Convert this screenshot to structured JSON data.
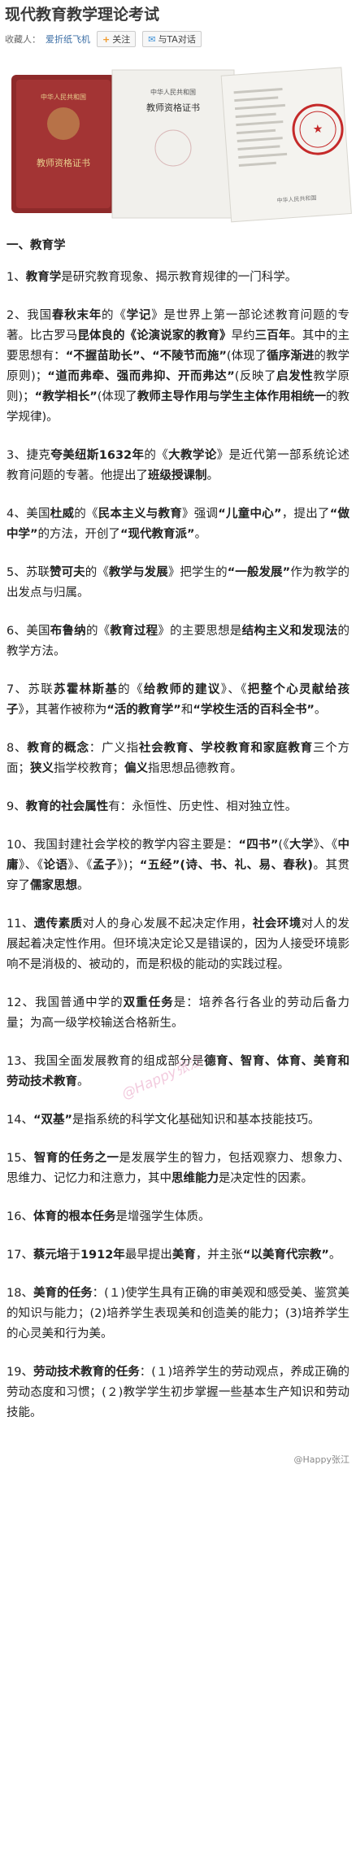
{
  "page": {
    "title": "现代教育教学理论考试",
    "meta": {
      "collector_label": "收藏人：",
      "author": "爱折纸飞机",
      "follow_label": "关注",
      "chat_label": "与TA对话"
    },
    "hero": {
      "card1_top": "中华人民共和国",
      "card1_main": "教师资格证书",
      "card2_top": "中华人民共和国",
      "card2_main": "教师资格证书",
      "card3_top": "中华人民共和国"
    },
    "section_title": "一、教育学",
    "paragraphs": [
      [
        {
          "t": "1、"
        },
        {
          "t": "教育学",
          "b": true
        },
        {
          "t": "是研究教育现象、揭示教育规律的一门科学。"
        }
      ],
      [
        {
          "t": "2、我国"
        },
        {
          "t": "春秋末年",
          "b": true
        },
        {
          "t": "的《"
        },
        {
          "t": "学记",
          "b": true
        },
        {
          "t": "》是世界上第一部论述教育问题的专著。比古罗马"
        },
        {
          "t": "昆体良的《论演说家的教育》",
          "b": true
        },
        {
          "t": "早约"
        },
        {
          "t": "三百年",
          "b": true
        },
        {
          "t": "。其中的主要思想有："
        },
        {
          "t": "“不握苗助长”、“不陵节而施”",
          "b": true
        },
        {
          "t": "(体现了"
        },
        {
          "t": "循序渐进",
          "b": true
        },
        {
          "t": "的教学原则)；"
        },
        {
          "t": "“道而弗牵、强而弗抑、开而弗达”",
          "b": true
        },
        {
          "t": "(反映了"
        },
        {
          "t": "启发性",
          "b": true
        },
        {
          "t": "教学原则)；"
        },
        {
          "t": "“教学相长”",
          "b": true
        },
        {
          "t": "(体现了"
        },
        {
          "t": "教师主导作用与学生主体作用相统一",
          "b": true
        },
        {
          "t": "的教学规律)。"
        }
      ],
      [
        {
          "t": "3、捷克"
        },
        {
          "t": "夸美纽斯1632年",
          "b": true
        },
        {
          "t": "的《"
        },
        {
          "t": "大教学论",
          "b": true
        },
        {
          "t": "》是近代第一部系统论述教育问题的专著。他提出了"
        },
        {
          "t": "班级授课制",
          "b": true
        },
        {
          "t": "。"
        }
      ],
      [
        {
          "t": "4、美国"
        },
        {
          "t": "杜威",
          "b": true
        },
        {
          "t": "的《"
        },
        {
          "t": "民本主义与教育",
          "b": true
        },
        {
          "t": "》强调"
        },
        {
          "t": "“儿童中心”",
          "b": true
        },
        {
          "t": "，提出了"
        },
        {
          "t": "“做中学”",
          "b": true
        },
        {
          "t": "的方法，开创了"
        },
        {
          "t": "“现代教育派”",
          "b": true
        },
        {
          "t": "。"
        }
      ],
      [
        {
          "t": "5、苏联"
        },
        {
          "t": "赞可夫",
          "b": true
        },
        {
          "t": "的《"
        },
        {
          "t": "教学与发展",
          "b": true
        },
        {
          "t": "》把学生的"
        },
        {
          "t": "“一般发展”",
          "b": true
        },
        {
          "t": "作为教学的出发点与归属。"
        }
      ],
      [
        {
          "t": "6、美国"
        },
        {
          "t": "布鲁纳",
          "b": true
        },
        {
          "t": "的《"
        },
        {
          "t": "教育过程",
          "b": true
        },
        {
          "t": "》的主要思想是"
        },
        {
          "t": "结构主义和发现法",
          "b": true
        },
        {
          "t": "的教学方法。"
        }
      ],
      [
        {
          "t": "7、苏联"
        },
        {
          "t": "苏霍林斯基",
          "b": true
        },
        {
          "t": "的《"
        },
        {
          "t": "给教师的建议",
          "b": true
        },
        {
          "t": "》、《"
        },
        {
          "t": "把整个心灵献给孩子",
          "b": true
        },
        {
          "t": "》，其著作被称为"
        },
        {
          "t": "“活的教育学”",
          "b": true
        },
        {
          "t": "和"
        },
        {
          "t": "“学校生活的百科全书”",
          "b": true
        },
        {
          "t": "。"
        }
      ],
      [
        {
          "t": "8、"
        },
        {
          "t": "教育的概念",
          "b": true
        },
        {
          "t": "：广义指"
        },
        {
          "t": "社会教育、学校教育和家庭教育",
          "b": true
        },
        {
          "t": "三个方面；"
        },
        {
          "t": "狭义",
          "b": true
        },
        {
          "t": "指学校教育；"
        },
        {
          "t": "偏义",
          "b": true
        },
        {
          "t": "指思想品德教育。"
        }
      ],
      [
        {
          "t": "9、"
        },
        {
          "t": "教育的社会属性",
          "b": true
        },
        {
          "t": "有：永恒性、历史性、相对独立性。"
        }
      ],
      [
        {
          "t": "10、我国封建社会学校的教学内容主要是："
        },
        {
          "t": "“四书”",
          "b": true
        },
        {
          "t": "(《"
        },
        {
          "t": "大学",
          "b": true
        },
        {
          "t": "》、《"
        },
        {
          "t": "中庸",
          "b": true
        },
        {
          "t": "》、《"
        },
        {
          "t": "论语",
          "b": true
        },
        {
          "t": "》、《"
        },
        {
          "t": "孟子",
          "b": true
        },
        {
          "t": "》)；"
        },
        {
          "t": "“五经”(诗、书、礼、易、春秋)",
          "b": true
        },
        {
          "t": "。其贯穿了"
        },
        {
          "t": "儒家思想",
          "b": true
        },
        {
          "t": "。"
        }
      ],
      [
        {
          "t": "11、"
        },
        {
          "t": "遗传素质",
          "b": true
        },
        {
          "t": "对人的身心发展不起决定作用，"
        },
        {
          "t": "社会环境",
          "b": true
        },
        {
          "t": "对人的发展起着决定性作用。但环境决定论又是错误的，因为人接受环境影响不是消极的、被动的，而是积极的能动的实践过程。"
        }
      ],
      [
        {
          "t": "12、我国普通中学的"
        },
        {
          "t": "双重任务",
          "b": true
        },
        {
          "t": "是：培养各行各业的劳动后备力量；为高一级学校输送合格新生。"
        }
      ],
      [
        {
          "t": "13、我国全面发展教育的组成部分是"
        },
        {
          "t": "德育、智育、体育、美育和劳动技术教育",
          "b": true
        },
        {
          "t": "。"
        }
      ],
      [
        {
          "t": "14、"
        },
        {
          "t": "“双基”",
          "b": true
        },
        {
          "t": "是指系统的科学文化基础知识和基本技能技巧。"
        }
      ],
      [
        {
          "t": "15、"
        },
        {
          "t": "智育的任务之一",
          "b": true
        },
        {
          "t": "是发展学生的智力，包括观察力、想象力、思维力、记忆力和注意力，其中"
        },
        {
          "t": "思维能力",
          "b": true
        },
        {
          "t": "是决定性的因素。"
        }
      ],
      [
        {
          "t": "16、"
        },
        {
          "t": "体育的根本任务",
          "b": true
        },
        {
          "t": "是增强学生体质。"
        }
      ],
      [
        {
          "t": "17、"
        },
        {
          "t": "蔡元培",
          "b": true
        },
        {
          "t": "于"
        },
        {
          "t": "1912年",
          "b": true
        },
        {
          "t": "最早提出"
        },
        {
          "t": "美育",
          "b": true
        },
        {
          "t": "，并主张"
        },
        {
          "t": "“以美育代宗教”",
          "b": true
        },
        {
          "t": "。"
        }
      ],
      [
        {
          "t": "18、"
        },
        {
          "t": "美育的任务",
          "b": true
        },
        {
          "t": "：(１)使学生具有正确的审美观和感受美、鉴赏美的知识与能力；(2)培养学生表现美和创造美的能力；(3)培养学生的心灵美和行为美。"
        }
      ],
      [
        {
          "t": "19、"
        },
        {
          "t": "劳动技术教育的任务",
          "b": true
        },
        {
          "t": "：(１)培养学生的劳动观点，养成正确的劳动态度和习惯；(２)教学学生初步掌握一些基本生产知识和劳动技能。"
        }
      ]
    ],
    "watermark": "@Happy张江",
    "footer": "@Happy张江"
  }
}
